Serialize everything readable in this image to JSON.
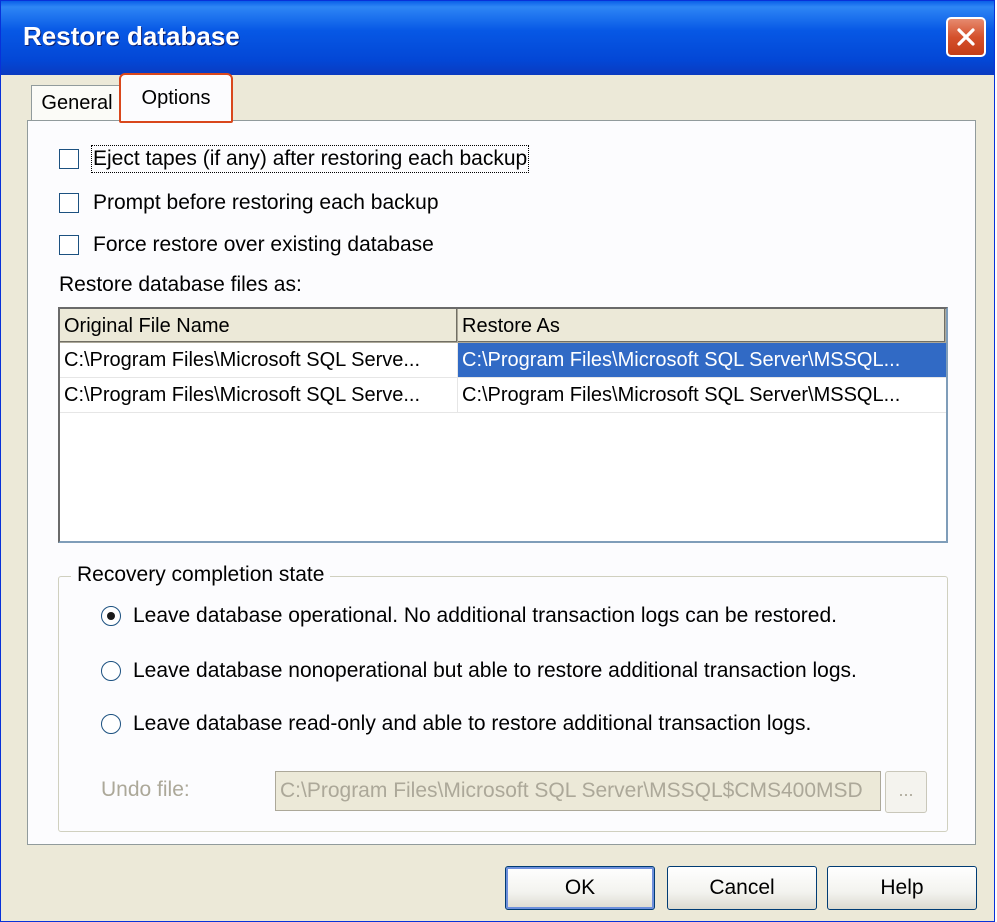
{
  "window": {
    "title": "Restore database"
  },
  "tabs": [
    {
      "label": "General"
    },
    {
      "label": "Options"
    }
  ],
  "options": {
    "checkboxes": [
      {
        "label": "Eject tapes (if any) after restoring each backup",
        "checked": false
      },
      {
        "label": "Prompt before restoring each backup",
        "checked": false
      },
      {
        "label": "Force restore over existing database",
        "checked": false
      }
    ],
    "files_label": "Restore database files as:",
    "table": {
      "columns": [
        "Original File Name",
        "Restore As"
      ],
      "rows": [
        [
          "C:\\Program Files\\Microsoft SQL Serve...",
          "C:\\Program Files\\Microsoft SQL Server\\MSSQL..."
        ],
        [
          "C:\\Program Files\\Microsoft SQL Serve...",
          "C:\\Program Files\\Microsoft SQL Server\\MSSQL..."
        ]
      ]
    },
    "recovery": {
      "title": "Recovery completion state",
      "radios": [
        {
          "label": "Leave database operational. No additional transaction logs can be restored.",
          "selected": true
        },
        {
          "label": "Leave database nonoperational but able to restore additional transaction logs.",
          "selected": false
        },
        {
          "label": "Leave database read-only and able to restore additional transaction logs.",
          "selected": false
        }
      ],
      "undo_label": "Undo file:",
      "undo_value": "C:\\Program Files\\Microsoft SQL Server\\MSSQL$CMS400MSD",
      "browse_label": "..."
    }
  },
  "buttons": {
    "ok": "OK",
    "cancel": "Cancel",
    "help": "Help"
  },
  "colors": {
    "titlebar": "#0758e5",
    "selection": "#316ac5",
    "tab_highlight": "#d9471c"
  }
}
